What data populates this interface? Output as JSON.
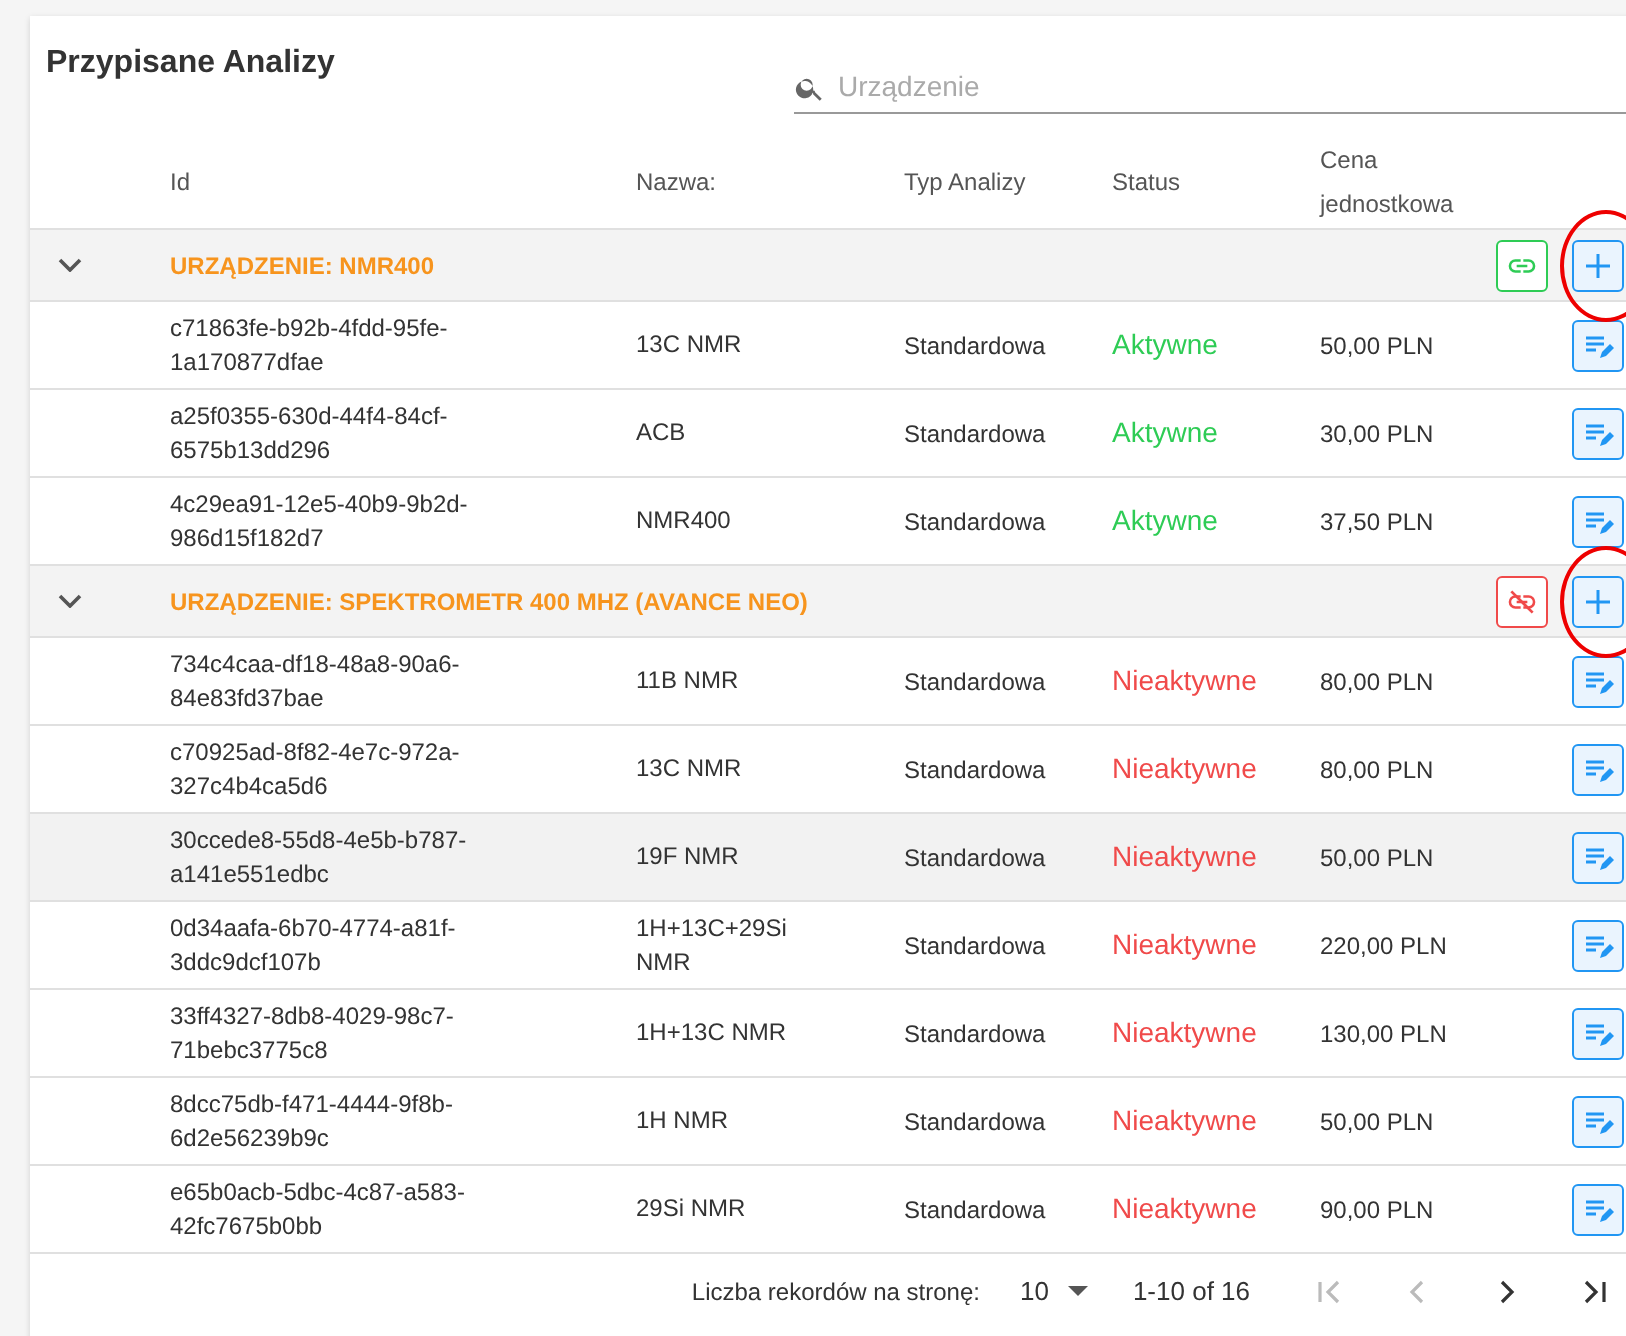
{
  "title": "Przypisane Analizy",
  "search": {
    "placeholder": "Urządzenie"
  },
  "columns": [
    "Id",
    "Nazwa:",
    "Typ Analizy",
    "Status",
    "Cena jednostkowa"
  ],
  "groups": [
    {
      "label": "URZĄDZENIE: NMR400",
      "expanded": true,
      "linked": true,
      "add_circled": true,
      "rows": [
        {
          "id": "c71863fe-b92b-4fdd-95fe-1a170877dfae",
          "name": "13C NMR",
          "type": "Standardowa",
          "status": "Aktywne",
          "active": true,
          "price": "50,00 PLN",
          "selected": false
        },
        {
          "id": "a25f0355-630d-44f4-84cf-6575b13dd296",
          "name": "ACB",
          "type": "Standardowa",
          "status": "Aktywne",
          "active": true,
          "price": "30,00 PLN",
          "selected": false
        },
        {
          "id": "4c29ea91-12e5-40b9-9b2d-986d15f182d7",
          "name": "NMR400",
          "type": "Standardowa",
          "status": "Aktywne",
          "active": true,
          "price": "37,50 PLN",
          "selected": false
        }
      ]
    },
    {
      "label": "URZĄDZENIE: SPEKTROMETR 400 MHZ (AVANCE NEO)",
      "expanded": true,
      "linked": false,
      "add_circled": true,
      "rows": [
        {
          "id": "734c4caa-df18-48a8-90a6-84e83fd37bae",
          "name": "11B NMR",
          "type": "Standardowa",
          "status": "Nieaktywne",
          "active": false,
          "price": "80,00 PLN",
          "selected": false
        },
        {
          "id": "c70925ad-8f82-4e7c-972a-327c4b4ca5d6",
          "name": "13C NMR",
          "type": "Standardowa",
          "status": "Nieaktywne",
          "active": false,
          "price": "80,00 PLN",
          "selected": false
        },
        {
          "id": "30ccede8-55d8-4e5b-b787-a141e551edbc",
          "name": "19F NMR",
          "type": "Standardowa",
          "status": "Nieaktywne",
          "active": false,
          "price": "50,00 PLN",
          "selected": true
        },
        {
          "id": "0d34aafa-6b70-4774-a81f-3ddc9dcf107b",
          "name": "1H+13C+29Si NMR",
          "type": "Standardowa",
          "status": "Nieaktywne",
          "active": false,
          "price": "220,00 PLN",
          "selected": false
        },
        {
          "id": "33ff4327-8db8-4029-98c7-71bebc3775c8",
          "name": "1H+13C NMR",
          "type": "Standardowa",
          "status": "Nieaktywne",
          "active": false,
          "price": "130,00 PLN",
          "selected": false
        },
        {
          "id": "8dcc75db-f471-4444-9f8b-6d2e56239b9c",
          "name": "1H NMR",
          "type": "Standardowa",
          "status": "Nieaktywne",
          "active": false,
          "price": "50,00 PLN",
          "selected": false
        },
        {
          "id": "e65b0acb-5dbc-4c87-a583-42fc7675b0bb",
          "name": "29Si NMR",
          "type": "Standardowa",
          "status": "Nieaktywne",
          "active": false,
          "price": "90,00 PLN",
          "selected": false
        }
      ]
    }
  ],
  "pagination": {
    "label": "Liczba rekordów na stronę:",
    "page_size": "10",
    "range": "1-10 of 16",
    "first_disabled": true,
    "prev_disabled": true,
    "next_disabled": false,
    "last_disabled": false
  }
}
